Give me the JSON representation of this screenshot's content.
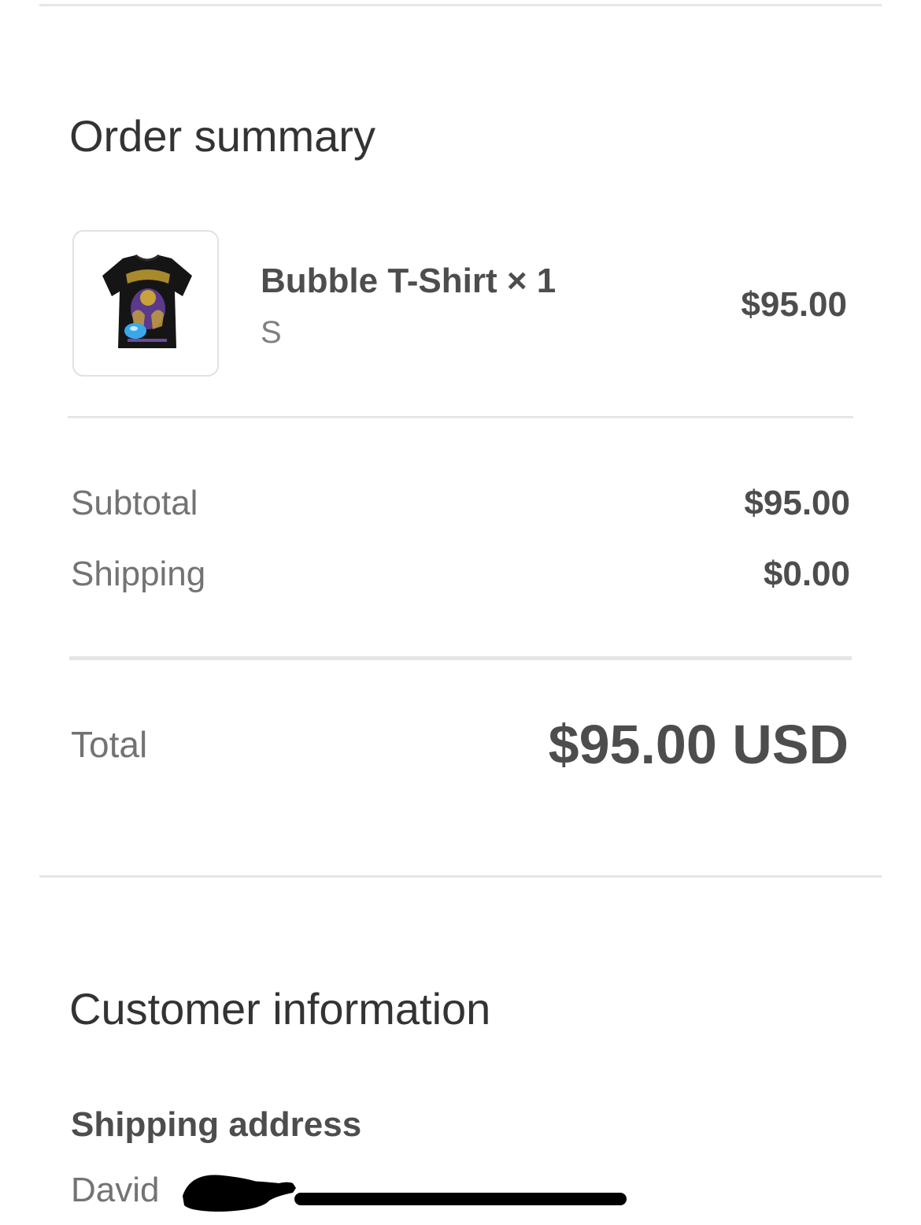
{
  "order_summary": {
    "title": "Order summary",
    "item": {
      "name": "Bubble T-Shirt × 1",
      "variant": "S",
      "price": "$95.00",
      "thumbnail_icon": "black-lakers-graphic-tshirt"
    },
    "subtotal_label": "Subtotal",
    "subtotal_value": "$95.00",
    "shipping_label": "Shipping",
    "shipping_value": "$0.00",
    "total_label": "Total",
    "total_value": "$95.00 USD"
  },
  "customer_information": {
    "title": "Customer information",
    "shipping_address_heading": "Shipping address",
    "name_visible": "David"
  },
  "colors": {
    "text_primary": "#333333",
    "text_secondary": "#737373",
    "divider": "#e6e6e6",
    "redaction": "#000000"
  }
}
